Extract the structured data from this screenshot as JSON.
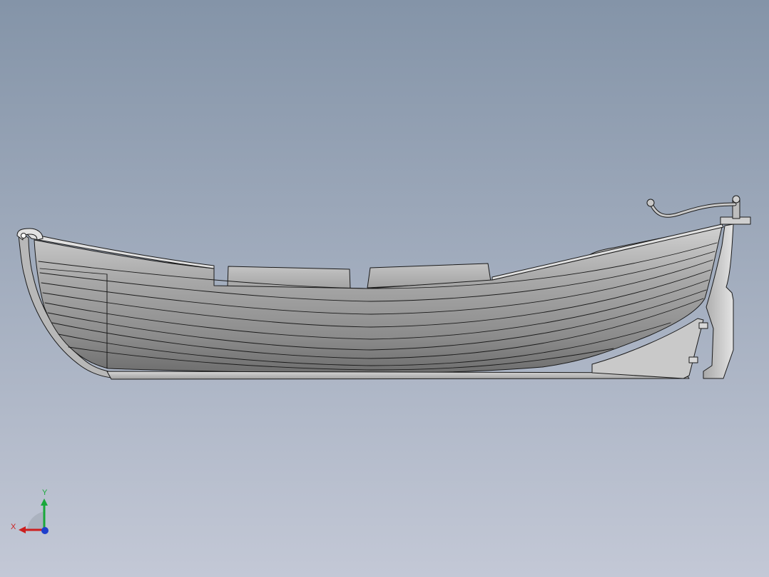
{
  "viewport": {
    "background_top": "#8494a8",
    "background_bottom": "#c3c8d6"
  },
  "model": {
    "name_icon": "rowboat-model-icon",
    "hull_color": "#9d9d9d",
    "edge_color": "#1a1a1a",
    "accent_light": "#d8d8d8"
  },
  "triad": {
    "x_label": "X",
    "y_label": "Y",
    "x_color": "#cc1f1f",
    "y_color": "#19a83a",
    "z_color": "#1f3fcc"
  }
}
